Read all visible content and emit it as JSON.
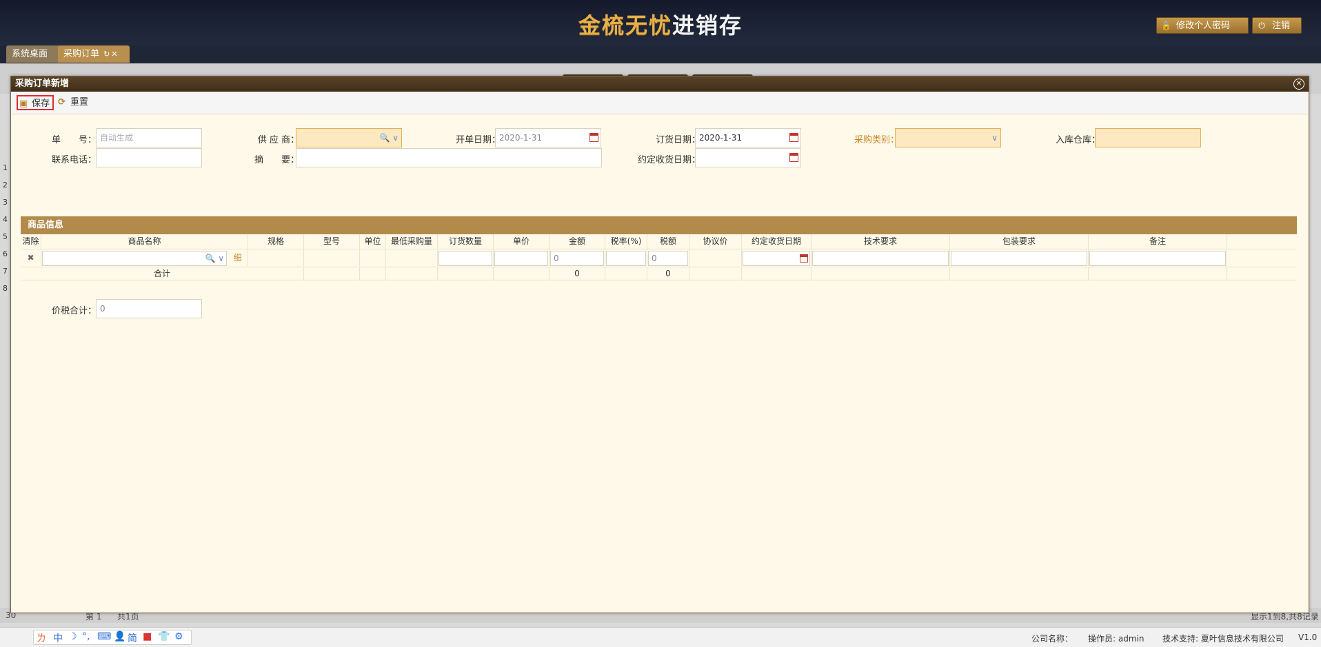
{
  "header": {
    "logo_gold": "金梳无忧",
    "logo_white": "进销存",
    "change_password": "修改个人密码",
    "logout": "注销"
  },
  "tabs": [
    {
      "label": "系统桌面"
    },
    {
      "label": "采购订单"
    }
  ],
  "modal": {
    "title": "采购订单新增",
    "toolbar": {
      "save": "保存",
      "reset": "重置"
    },
    "form": {
      "order_no": {
        "label": "单　　号：",
        "placeholder": "自动生成"
      },
      "supplier": {
        "label": "供 应 商：",
        "value": ""
      },
      "open_date": {
        "label": "开单日期：",
        "value": "2020-1-31"
      },
      "order_date": {
        "label": "订货日期：",
        "value": "2020-1-31"
      },
      "purchase_type": {
        "label": "采购类别：",
        "value": ""
      },
      "warehouse": {
        "label": "入库仓库：",
        "value": ""
      },
      "phone": {
        "label": "联系电话：",
        "value": ""
      },
      "summary": {
        "label": "摘　　要：",
        "value": ""
      },
      "agreed_receive_date": {
        "label": "约定收货日期：",
        "value": ""
      }
    },
    "goods": {
      "title": "商品信息",
      "columns": [
        "清除",
        "商品名称",
        "规格",
        "型号",
        "单位",
        "最低采购量",
        "订货数量",
        "单价",
        "金额",
        "税率(%)",
        "税额",
        "协议价",
        "约定收货日期",
        "技术要求",
        "包装要求",
        "备注"
      ],
      "row": {
        "clear": "✖",
        "detail": "细",
        "amount": "0",
        "tax": "0"
      },
      "total": {
        "label": "合计",
        "amount": "0",
        "tax": "0"
      }
    },
    "tax_total": {
      "label": "价税合计：",
      "value": "0"
    }
  },
  "background_grid": {
    "row_numbers": [
      "1",
      "2",
      "3",
      "4",
      "5",
      "6",
      "7",
      "8"
    ],
    "pager": {
      "page_size": "30",
      "page_label": "第 1",
      "pages": "共1页",
      "summary": "显示1到8,共8记录"
    }
  },
  "statusbar": {
    "company": "公司名称：",
    "operator": "操作员: admin",
    "support": "技术支持: 夏叶信息技术有限公司",
    "version": "V1.0"
  },
  "colors": {
    "accent_gold": "#b28a4a",
    "header_dark": "#1d2436",
    "form_bg": "#fef9e8",
    "save_highlight": "#e02b2b"
  }
}
